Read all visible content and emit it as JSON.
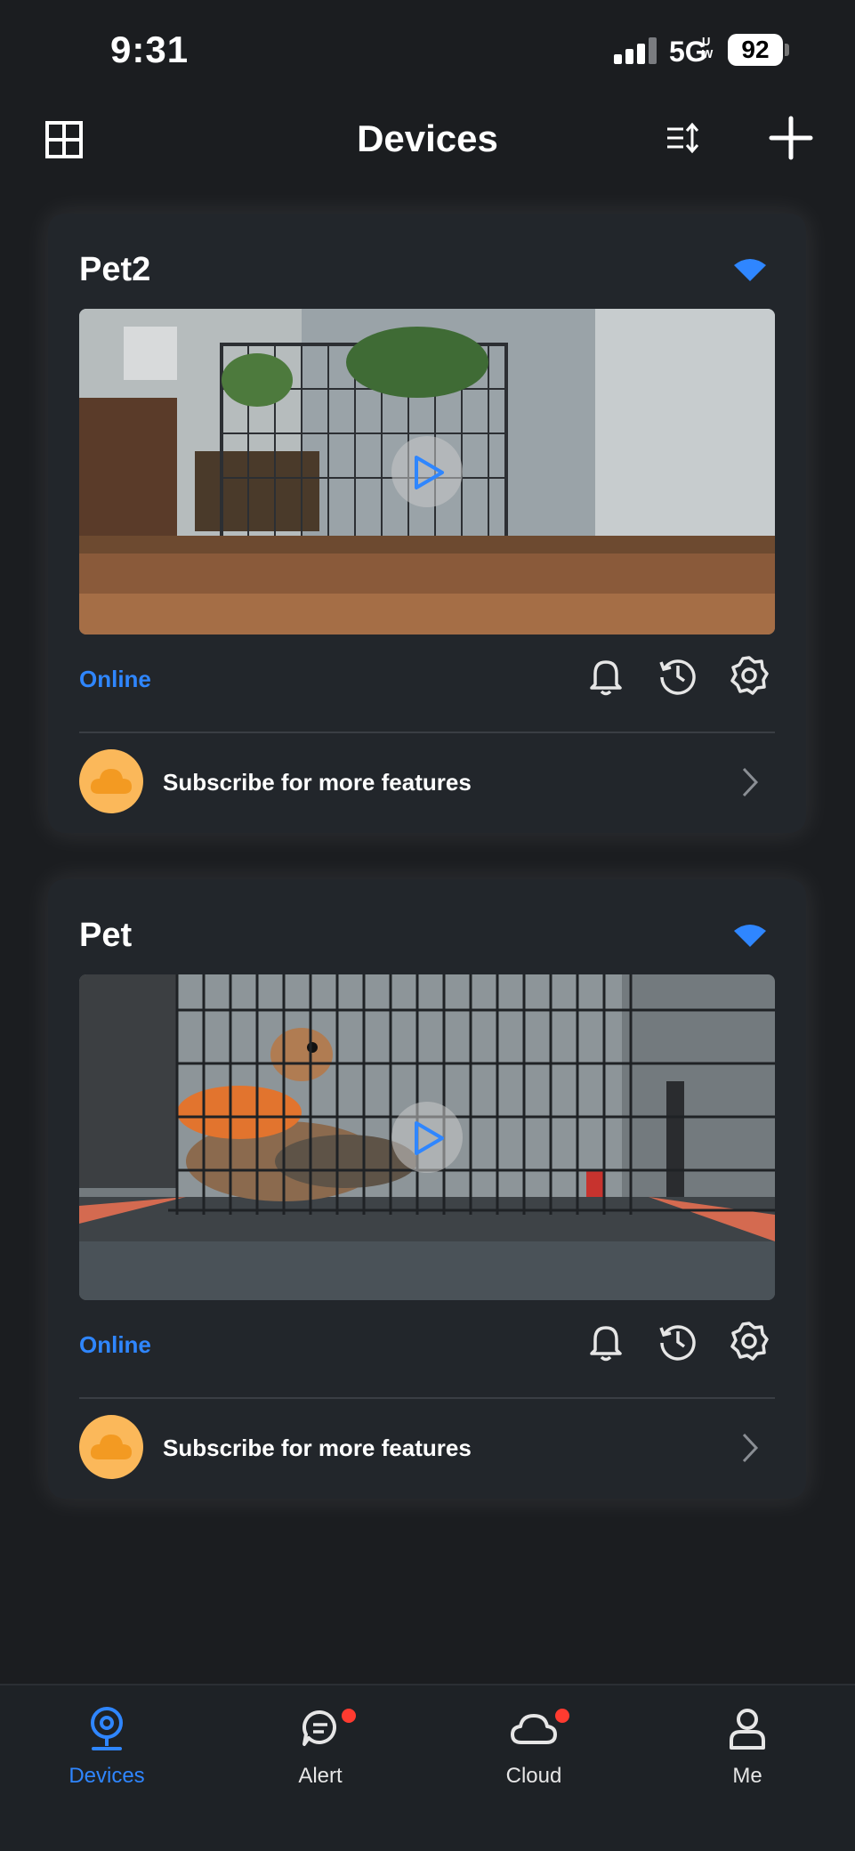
{
  "status_bar": {
    "time": "9:31",
    "network": "5G",
    "network_sup": "UW",
    "battery": "92"
  },
  "header": {
    "title": "Devices"
  },
  "devices": [
    {
      "name": "Pet2",
      "status": "Online",
      "subscribe_label": "Subscribe for more features"
    },
    {
      "name": "Pet",
      "status": "Online",
      "subscribe_label": "Subscribe for more features"
    }
  ],
  "bottom_nav": [
    {
      "label": "Devices",
      "active": true,
      "badge": false
    },
    {
      "label": "Alert",
      "active": false,
      "badge": true
    },
    {
      "label": "Cloud",
      "active": false,
      "badge": true
    },
    {
      "label": "Me",
      "active": false,
      "badge": false
    }
  ],
  "colors": {
    "accent": "#2f86ff",
    "background": "#1b1d20",
    "card": "#22262b",
    "cloud_badge": "#fbb85a",
    "badge_dot": "#ff3b30"
  },
  "icons": [
    "grid-icon",
    "sort-icon",
    "plus-icon",
    "wifi-icon",
    "play-icon",
    "bell-icon",
    "history-icon",
    "settings-icon",
    "cloud-icon",
    "chevron-right-icon",
    "camera-icon",
    "message-icon",
    "cloud-icon",
    "user-icon"
  ]
}
